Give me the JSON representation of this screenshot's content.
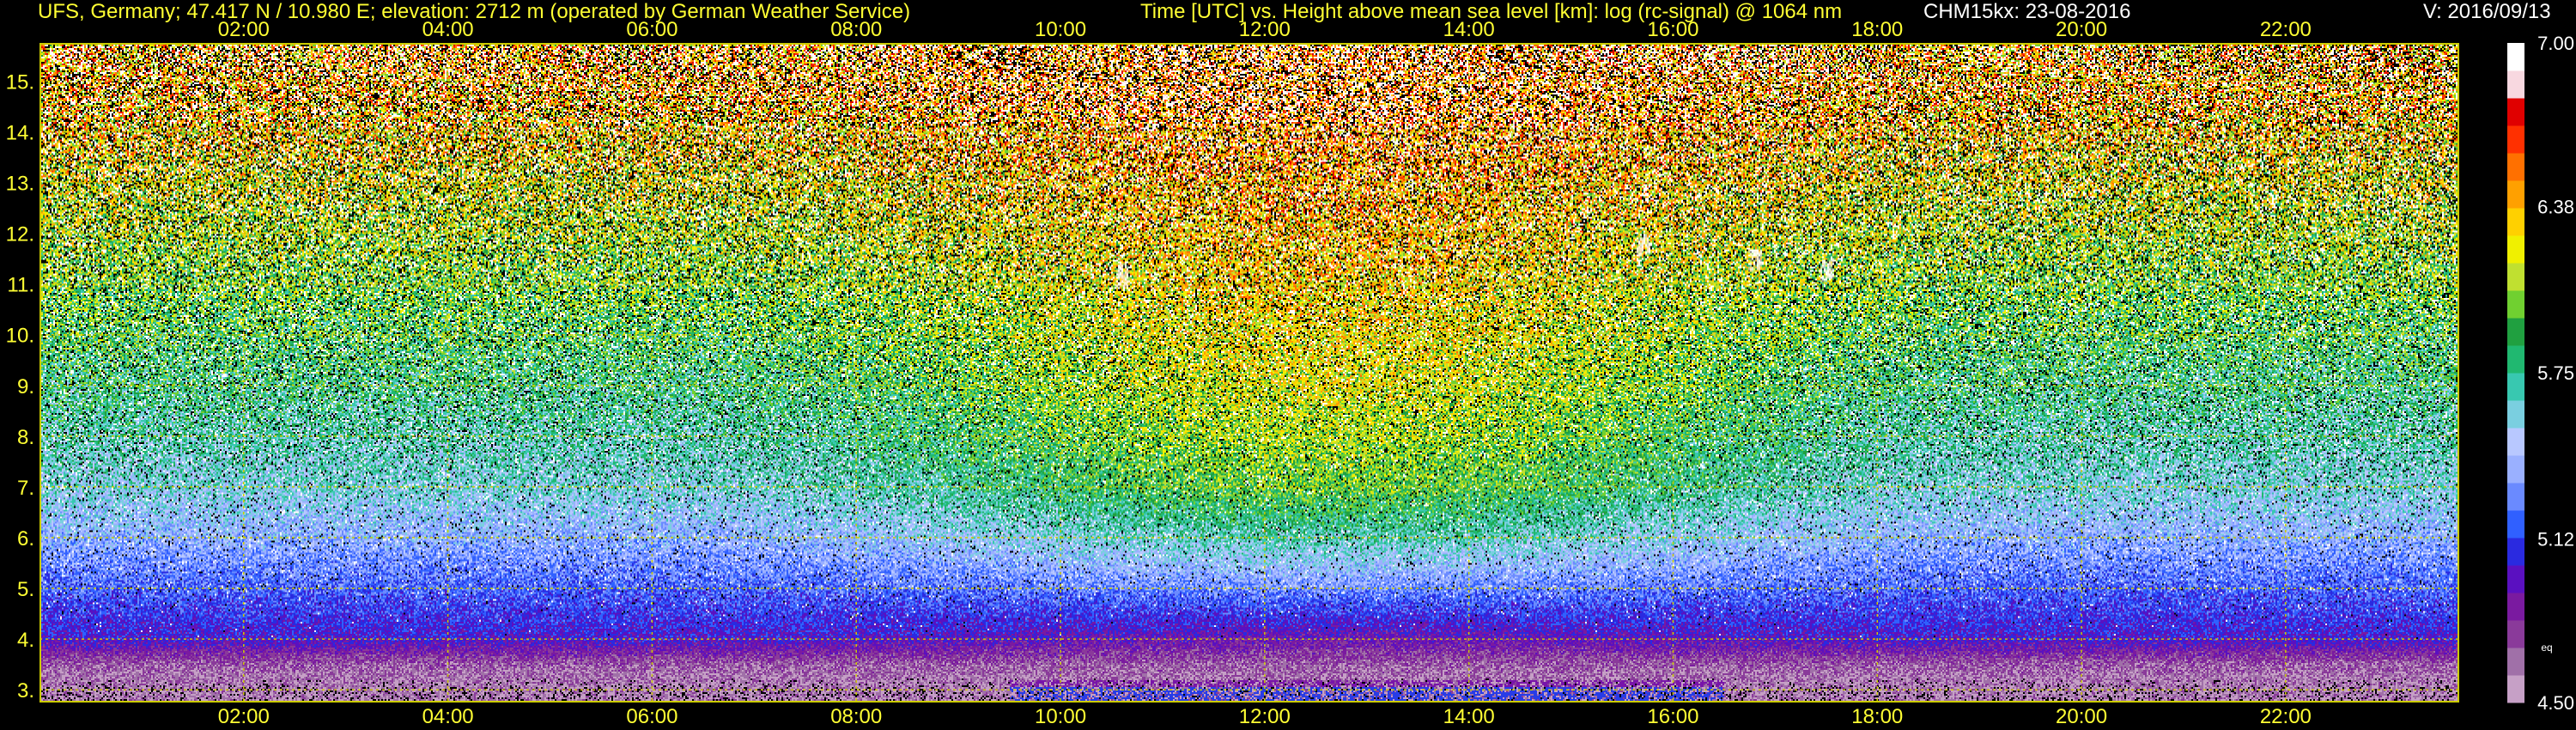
{
  "header": {
    "site": "UFS, Germany; 47.417 N / 10.980 E; elevation: 2712 m  (operated by German Weather Service)",
    "title": "Time [UTC] vs. Height above mean sea level [km]: log (rc-signal) @ 1064 nm",
    "instrument": "CHM15kx: 23-08-2016",
    "version": "V: 2016/09/13"
  },
  "colors": {
    "background": "#000000",
    "text": "#ffff33",
    "grid": "#cccc00"
  },
  "chart_data": {
    "type": "heatmap",
    "title": "Time [UTC] vs. Height above mean sea level [km]: log (rc-signal) @ 1064 nm",
    "xlabel": "Time [UTC]",
    "ylabel": "Height above mean sea level [km]",
    "x_ticks": [
      "02:00",
      "04:00",
      "06:00",
      "08:00",
      "10:00",
      "12:00",
      "14:00",
      "16:00",
      "18:00",
      "20:00",
      "22:00"
    ],
    "x_tick_hours": [
      2,
      4,
      6,
      8,
      10,
      12,
      14,
      16,
      18,
      20,
      22
    ],
    "xlim": [
      0,
      23.7
    ],
    "y_ticks": [
      3,
      4,
      5,
      6,
      7,
      8,
      9,
      10,
      11,
      12,
      13,
      14,
      15
    ],
    "ylim": [
      2.75,
      15.75
    ],
    "grid": true,
    "colorbar": {
      "label": "log (rc-signal)",
      "range": [
        4.5,
        7.0
      ],
      "ticks": [
        4.5,
        5.12,
        5.75,
        6.38,
        7.0
      ],
      "tick_labels": [
        "4.50",
        "5.12",
        "5.75",
        "6.38",
        "7.00"
      ],
      "extra_label": "eq",
      "colors": [
        "#c6a0c6",
        "#a070a8",
        "#8a3a9a",
        "#7a1aa0",
        "#5a10c0",
        "#2a2ae0",
        "#3060ff",
        "#6a8aff",
        "#9ab0ff",
        "#b8c8ff",
        "#7acfe0",
        "#38c8b0",
        "#20b870",
        "#20a040",
        "#70d030",
        "#c0e030",
        "#f0f000",
        "#ffd000",
        "#ffa000",
        "#ff7000",
        "#ff3000",
        "#e00000",
        "#f8d8e0",
        "#ffffff"
      ]
    },
    "signal_profile": {
      "heights_km": [
        3.0,
        3.5,
        4.0,
        5.0,
        6.0,
        7.0,
        8.0,
        9.0,
        10.0,
        11.0,
        12.0,
        13.0,
        14.0,
        15.0
      ],
      "night_value": [
        4.6,
        4.7,
        5.0,
        5.2,
        5.4,
        5.6,
        5.7,
        5.8,
        5.9,
        6.0,
        6.1,
        6.2,
        6.3,
        6.4
      ],
      "day_value": [
        4.6,
        4.7,
        4.9,
        5.3,
        5.7,
        6.0,
        6.1,
        6.2,
        6.25,
        6.3,
        6.35,
        6.4,
        6.5,
        6.6
      ]
    },
    "boundary_layer": {
      "start_hour": 9.5,
      "end_hour": 16.5,
      "top_km": 3.1
    },
    "clouds": [
      {
        "hour": 10.6,
        "height_km": 11.2
      },
      {
        "hour": 15.7,
        "height_km": 11.8
      },
      {
        "hour": 16.8,
        "height_km": 11.5
      },
      {
        "hour": 17.5,
        "height_km": 11.3
      }
    ]
  }
}
